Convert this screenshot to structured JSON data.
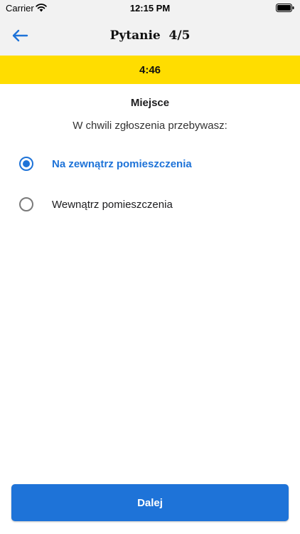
{
  "status_bar": {
    "carrier": "Carrier",
    "time": "12:15 PM",
    "icons": [
      "wifi-icon",
      "battery-icon"
    ]
  },
  "nav": {
    "back_icon": "arrow-left-icon",
    "title": "Pytanie  4/5"
  },
  "timer": {
    "value": "4:46"
  },
  "question": {
    "section": "Miejsce",
    "text": "W chwili zgłoszenia przebywasz:",
    "options": [
      {
        "label": "Na zewnątrz pomieszczenia",
        "selected": true
      },
      {
        "label": "Wewnątrz pomieszczenia",
        "selected": false
      }
    ]
  },
  "footer": {
    "next_label": "Dalej"
  },
  "colors": {
    "accent": "#1e73d8",
    "timer_bg": "#ffdd00",
    "header_bg": "#f2f2f2"
  }
}
